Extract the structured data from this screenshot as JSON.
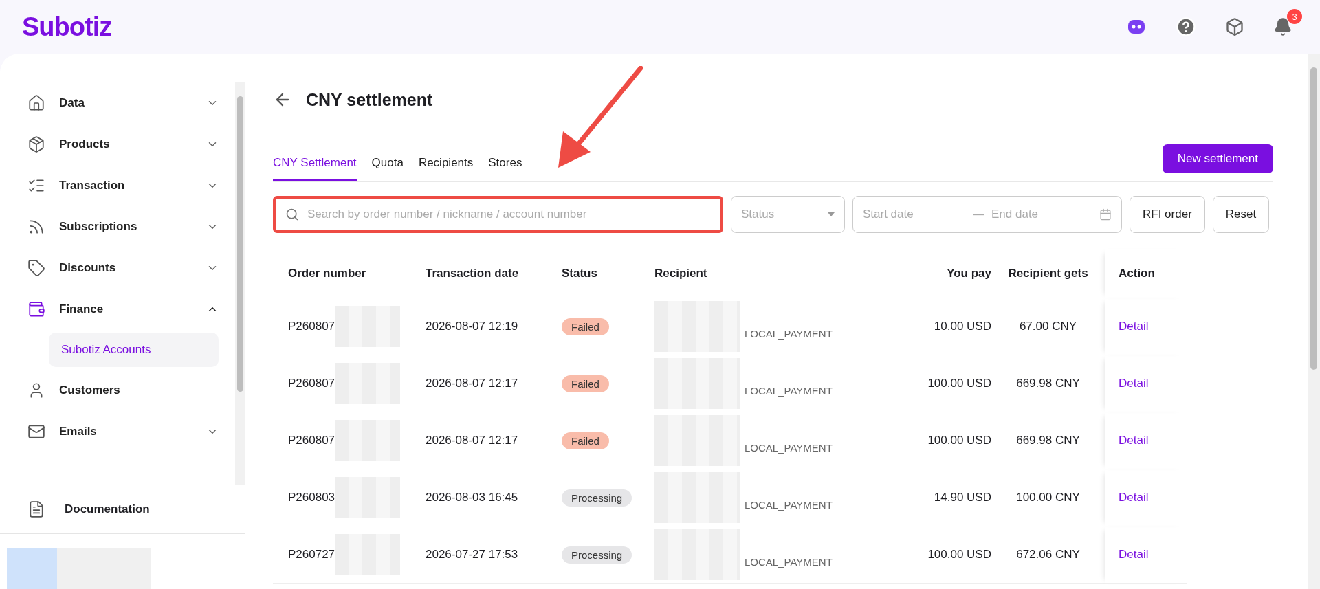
{
  "brand": "Subotiz",
  "header": {
    "notifications": "3"
  },
  "sidebar": {
    "items": [
      {
        "label": "Data",
        "expanded": false,
        "selected": false
      },
      {
        "label": "Products",
        "expanded": false,
        "selected": false
      },
      {
        "label": "Transaction",
        "expanded": false,
        "selected": false
      },
      {
        "label": "Subscriptions",
        "expanded": false,
        "selected": false
      },
      {
        "label": "Discounts",
        "expanded": false,
        "selected": false
      },
      {
        "label": "Finance",
        "expanded": true,
        "selected": true,
        "children": [
          {
            "label": "Subotiz Accounts",
            "selected": true
          }
        ]
      },
      {
        "label": "Customers",
        "selected": false
      },
      {
        "label": "Emails",
        "expanded": false,
        "selected": false
      }
    ],
    "footer_link": "Documentation"
  },
  "page": {
    "title": "CNY settlement",
    "tabs": [
      {
        "label": "CNY Settlement",
        "selected": true
      },
      {
        "label": "Quota",
        "selected": false
      },
      {
        "label": "Recipients",
        "selected": false
      },
      {
        "label": "Stores",
        "selected": false
      }
    ],
    "primary_button": "New settlement",
    "filters": {
      "search": {
        "placeholder": "Search by order number / nickname / account number",
        "highlighted": true
      },
      "status": {
        "placeholder": "Status"
      },
      "date_range": {
        "start_placeholder": "Start date",
        "separator": "—",
        "end_placeholder": "End date"
      },
      "buttons": [
        "RFI order",
        "Reset"
      ]
    },
    "table": {
      "columns": [
        "Order number",
        "Transaction date",
        "Status",
        "Recipient",
        "You pay",
        "Recipient gets",
        "Action"
      ],
      "rows": [
        {
          "order": "P260807",
          "date": "2026-08-07 12:19",
          "status": {
            "label": "Failed",
            "color": "#f9bcaa"
          },
          "method": "LOCAL_PAYMENT",
          "pay": "10.00 USD",
          "gets": "67.00 CNY",
          "action": "Detail"
        },
        {
          "order": "P260807",
          "date": "2026-08-07 12:17",
          "status": {
            "label": "Failed",
            "color": "#f9bcaa"
          },
          "method": "LOCAL_PAYMENT",
          "pay": "100.00 USD",
          "gets": "669.98 CNY",
          "action": "Detail"
        },
        {
          "order": "P260807",
          "date": "2026-08-07 12:17",
          "status": {
            "label": "Failed",
            "color": "#f9bcaa"
          },
          "method": "LOCAL_PAYMENT",
          "pay": "100.00 USD",
          "gets": "669.98 CNY",
          "action": "Detail"
        },
        {
          "order": "P260803",
          "date": "2026-08-03 16:45",
          "status": {
            "label": "Processing",
            "color": "#e6e6e8"
          },
          "method": "LOCAL_PAYMENT",
          "pay": "14.90 USD",
          "gets": "100.00 CNY",
          "action": "Detail"
        },
        {
          "order": "P260727",
          "date": "2026-07-27 17:53",
          "status": {
            "label": "Processing",
            "color": "#e6e6e8"
          },
          "method": "LOCAL_PAYMENT",
          "pay": "100.00 USD",
          "gets": "672.06 CNY",
          "action": "Detail"
        }
      ]
    }
  }
}
